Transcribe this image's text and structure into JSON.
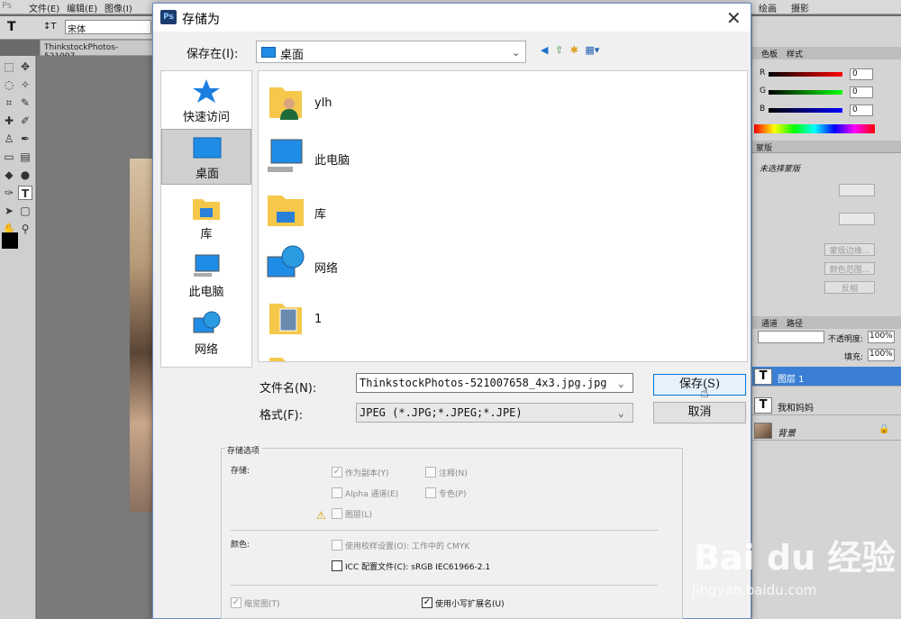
{
  "photoshop": {
    "menu": [
      "文件(E)",
      "编辑(E)",
      "图像(I)",
      "绘画",
      "摄影"
    ],
    "font_name": "宋体",
    "doc_tab": "ThinkstockPhotos-521007...",
    "color_panel": {
      "tabs": [
        "色板",
        "样式"
      ],
      "r": "0",
      "g": "0",
      "b": "0"
    },
    "mask_panel": {
      "tab": "蒙版",
      "title": "未选择蒙版",
      "buttons": [
        "蒙版边缘...",
        "颜色范围...",
        "反相"
      ]
    },
    "layers_panel": {
      "tabs": [
        "通道",
        "路径"
      ],
      "opacity_label": "不透明度:",
      "opacity": "100%",
      "fill_label": "填充:",
      "fill": "100%",
      "layers": [
        {
          "name": "图层 1",
          "type": "T",
          "selected": true
        },
        {
          "name": "我和妈妈",
          "type": "T",
          "selected": false
        },
        {
          "name": "背景",
          "type": "img",
          "selected": false
        }
      ]
    }
  },
  "dialog": {
    "title": "存储为",
    "save_in_label": "保存在(I):",
    "save_in_value": "桌面",
    "places": [
      {
        "label": "快速访问",
        "icon": "star-icon"
      },
      {
        "label": "桌面",
        "icon": "desktop-icon",
        "selected": true
      },
      {
        "label": "库",
        "icon": "library-icon"
      },
      {
        "label": "此电脑",
        "icon": "computer-icon"
      },
      {
        "label": "网络",
        "icon": "network-icon"
      }
    ],
    "files": [
      {
        "name": "ylh",
        "icon": "user-folder-icon"
      },
      {
        "name": "此电脑",
        "icon": "computer-icon"
      },
      {
        "name": "库",
        "icon": "library-icon"
      },
      {
        "name": "网络",
        "icon": "network-icon"
      },
      {
        "name": "1",
        "icon": "photo-folder-icon"
      },
      {
        "name": "",
        "icon": "folder-icon"
      }
    ],
    "filename_label": "文件名(N):",
    "filename_value": "ThinkstockPhotos-521007658_4x3.jpg.jpg",
    "format_label": "格式(F):",
    "format_value": "JPEG (*.JPG;*.JPEG;*.JPE)",
    "save_button": "保存(S)",
    "cancel_button": "取消",
    "options": {
      "group_title": "存储选项",
      "store_label": "存储:",
      "as_copy": "作为副本(Y)",
      "notes": "注释(N)",
      "alpha": "Alpha 通道(E)",
      "spot": "专色(P)",
      "layers": "图层(L)",
      "color_label": "颜色:",
      "proof": "使用校样设置(O): 工作中的 CMYK",
      "icc": "ICC 配置文件(C): sRGB IEC61966-2.1",
      "thumbnail": "缩览图(T)",
      "lowercase": "使用小写扩展名(U)"
    }
  },
  "watermark": {
    "brand": "Bai du 经验",
    "url": "jingyan.baidu.com"
  }
}
